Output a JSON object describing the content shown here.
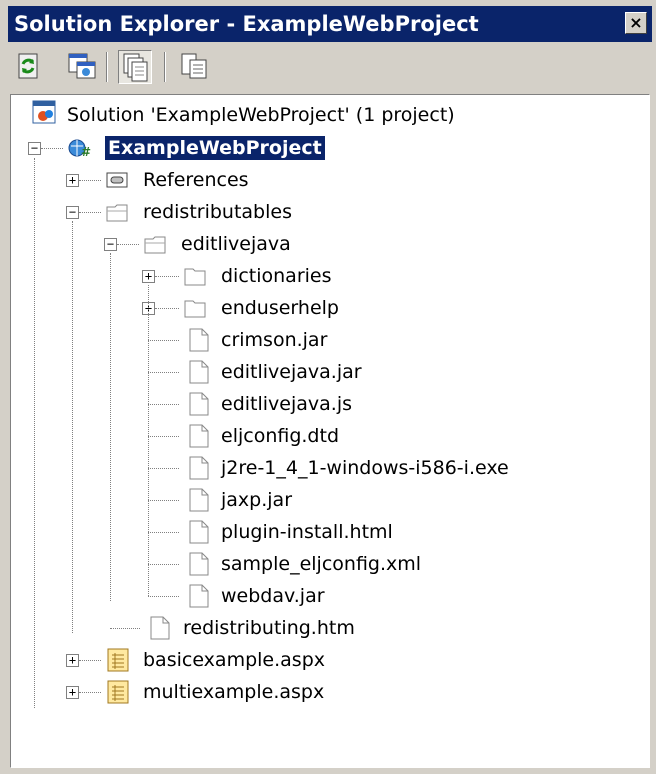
{
  "window": {
    "title": "Solution Explorer - ExampleWebProject",
    "close_glyph": "×"
  },
  "toolbar": {
    "buttons": [
      {
        "icon": "refresh-icon"
      },
      {
        "icon": "copy-project-icon"
      },
      {
        "icon": "show-all-files-icon",
        "pressed": true
      },
      {
        "icon": "properties-icon"
      }
    ]
  },
  "tree": {
    "solution_label": "Solution 'ExampleWebProject' (1 project)",
    "project_label": "ExampleWebProject",
    "references_label": "References",
    "redistributables_label": "redistributables",
    "editlivejava_label": "editlivejava",
    "dictionaries_label": "dictionaries",
    "enduserhelp_label": "enduserhelp",
    "files": [
      "crimson.jar",
      "editlivejava.jar",
      "editlivejava.js",
      "eljconfig.dtd",
      "j2re-1_4_1-windows-i586-i.exe",
      "jaxp.jar",
      "plugin-install.html",
      "sample_eljconfig.xml",
      "webdav.jar"
    ],
    "redistributing_label": "redistributing.htm",
    "basicexample_label": "basicexample.aspx",
    "multiexample_label": "multiexample.aspx",
    "plus_glyph": "+",
    "minus_glyph": "−"
  },
  "colors": {
    "titlebar": "#0a246a",
    "selection": "#0a246a",
    "chrome": "#d4d0c8"
  }
}
